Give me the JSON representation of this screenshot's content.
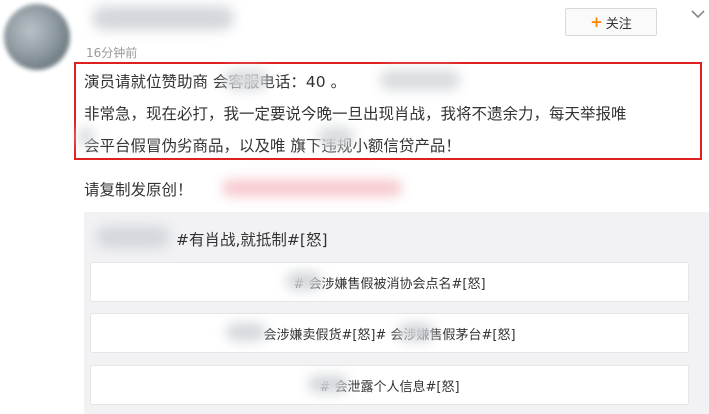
{
  "post": {
    "timestamp": "16分钟前",
    "follow_label": "关注",
    "follow_plus": "+",
    "lines": [
      "演员请就位赞助商        会客服电话：40              。",
      "非常急，现在必打，我一定要说今晚一旦出现肖战，我将不遗余力，每天举报唯",
      "  会平台假冒伪劣商品，以及唯      旗下违规小额信贷产品！"
    ]
  },
  "repost": {
    "label": "请复制发原创！"
  },
  "quote": {
    "hashtag": "#有肖战,就抵制#[怒]",
    "tags": [
      "#         会涉嫌售假被消协会点名#[怒]",
      "          会涉嫌卖假货#[怒]#            会涉嫌售假茅台#[怒]",
      "#          会泄露个人信息#[怒]"
    ]
  },
  "colors": {
    "highlight_border": "#e02020",
    "follow_plus": "#ff8200",
    "quote_background": "#f2f2f5"
  }
}
